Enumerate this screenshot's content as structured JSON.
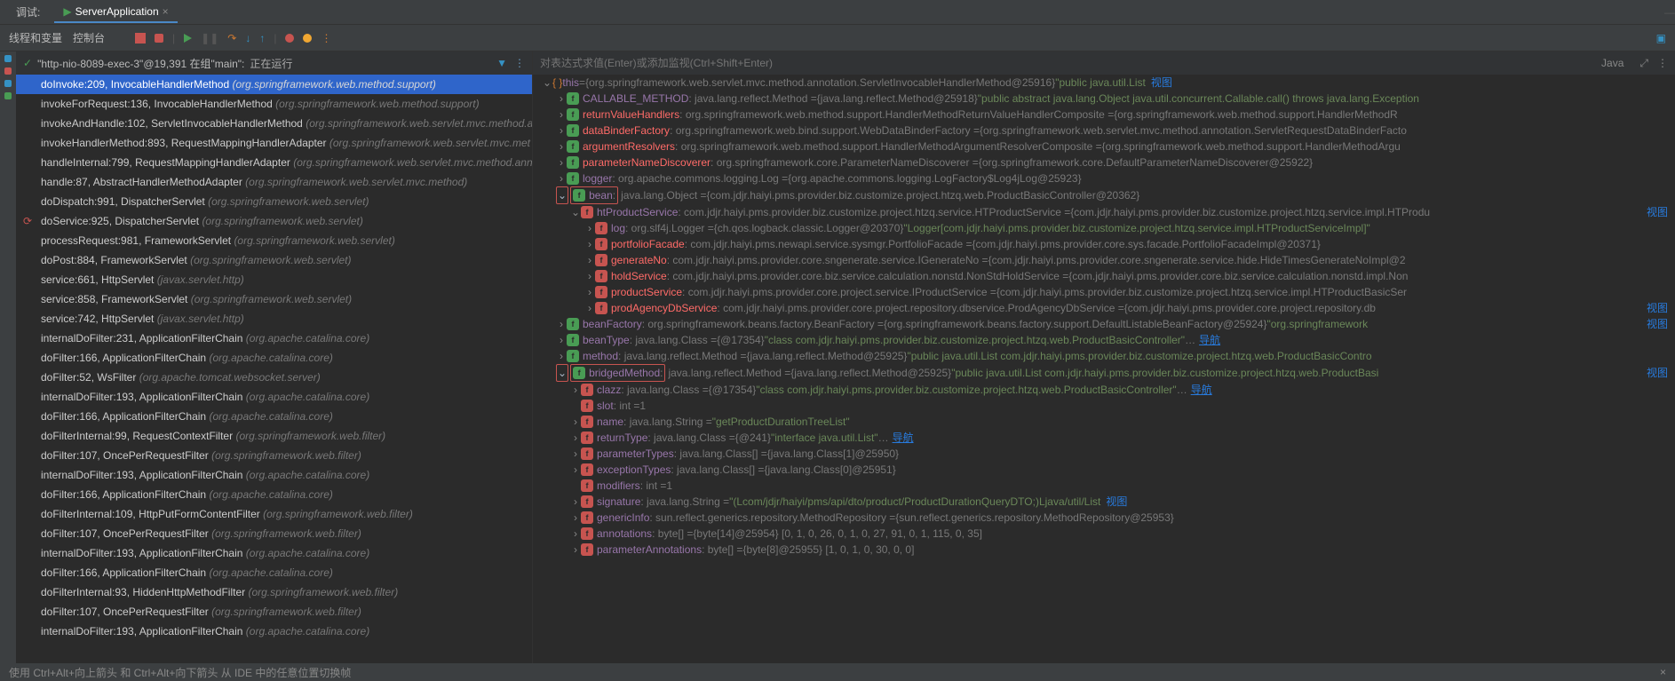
{
  "tabs": {
    "debug": "调试:",
    "app": "ServerApplication"
  },
  "toolbar": {
    "threads": "线程和变量",
    "console": "控制台"
  },
  "thread": {
    "prefix": "\"http-nio-8089-exec-3\"@19,391 在组\"main\":",
    "status": "正在运行"
  },
  "evaluator": {
    "placeholder": "对表达式求值(Enter)或添加监视(Ctrl+Shift+Enter)",
    "lang": "Java"
  },
  "viewLabel": "视图",
  "navLabel": "导航",
  "stack": [
    {
      "m": "doInvoke:209, InvocableHandlerMethod",
      "p": "(org.springframework.web.method.support)",
      "active": true
    },
    {
      "m": "invokeForRequest:136, InvocableHandlerMethod",
      "p": "(org.springframework.web.method.support)"
    },
    {
      "m": "invokeAndHandle:102, ServletInvocableHandlerMethod",
      "p": "(org.springframework.web.servlet.mvc.method.an"
    },
    {
      "m": "invokeHandlerMethod:893, RequestMappingHandlerAdapter",
      "p": "(org.springframework.web.servlet.mvc.met"
    },
    {
      "m": "handleInternal:799, RequestMappingHandlerAdapter",
      "p": "(org.springframework.web.servlet.mvc.method.ann"
    },
    {
      "m": "handle:87, AbstractHandlerMethodAdapter",
      "p": "(org.springframework.web.servlet.mvc.method)"
    },
    {
      "m": "doDispatch:991, DispatcherServlet",
      "p": "(org.springframework.web.servlet)"
    },
    {
      "m": "doService:925, DispatcherServlet",
      "p": "(org.springframework.web.servlet)",
      "refresh": true
    },
    {
      "m": "processRequest:981, FrameworkServlet",
      "p": "(org.springframework.web.servlet)"
    },
    {
      "m": "doPost:884, FrameworkServlet",
      "p": "(org.springframework.web.servlet)"
    },
    {
      "m": "service:661, HttpServlet",
      "p": "(javax.servlet.http)"
    },
    {
      "m": "service:858, FrameworkServlet",
      "p": "(org.springframework.web.servlet)"
    },
    {
      "m": "service:742, HttpServlet",
      "p": "(javax.servlet.http)"
    },
    {
      "m": "internalDoFilter:231, ApplicationFilterChain",
      "p": "(org.apache.catalina.core)"
    },
    {
      "m": "doFilter:166, ApplicationFilterChain",
      "p": "(org.apache.catalina.core)"
    },
    {
      "m": "doFilter:52, WsFilter",
      "p": "(org.apache.tomcat.websocket.server)"
    },
    {
      "m": "internalDoFilter:193, ApplicationFilterChain",
      "p": "(org.apache.catalina.core)"
    },
    {
      "m": "doFilter:166, ApplicationFilterChain",
      "p": "(org.apache.catalina.core)"
    },
    {
      "m": "doFilterInternal:99, RequestContextFilter",
      "p": "(org.springframework.web.filter)"
    },
    {
      "m": "doFilter:107, OncePerRequestFilter",
      "p": "(org.springframework.web.filter)"
    },
    {
      "m": "internalDoFilter:193, ApplicationFilterChain",
      "p": "(org.apache.catalina.core)"
    },
    {
      "m": "doFilter:166, ApplicationFilterChain",
      "p": "(org.apache.catalina.core)"
    },
    {
      "m": "doFilterInternal:109, HttpPutFormContentFilter",
      "p": "(org.springframework.web.filter)"
    },
    {
      "m": "doFilter:107, OncePerRequestFilter",
      "p": "(org.springframework.web.filter)"
    },
    {
      "m": "internalDoFilter:193, ApplicationFilterChain",
      "p": "(org.apache.catalina.core)"
    },
    {
      "m": "doFilter:166, ApplicationFilterChain",
      "p": "(org.apache.catalina.core)"
    },
    {
      "m": "doFilterInternal:93, HiddenHttpMethodFilter",
      "p": "(org.springframework.web.filter)"
    },
    {
      "m": "doFilter:107, OncePerRequestFilter",
      "p": "(org.springframework.web.filter)"
    },
    {
      "m": "internalDoFilter:193, ApplicationFilterChain",
      "p": "(org.apache.catalina.core)"
    }
  ],
  "vars": [
    {
      "d": 0,
      "arr": "v",
      "ic": "braces",
      "name": "this",
      "eq": " = ",
      "val": "{org.springframework.web.servlet.mvc.method.annotation.ServletInvocableHandlerMethod@25916} ",
      "str": "\"public java.util.List<com.jdjr.haiyi.pms.provider.biz.customize.proj",
      "view": true
    },
    {
      "d": 1,
      "arr": ">",
      "ic": "g",
      "name": "CALLABLE_METHOD",
      "red": false,
      "type": ": java.lang.reflect.Method  = ",
      "val": "{java.lang.reflect.Method@25918} ",
      "str": "\"public abstract java.lang.Object java.util.concurrent.Callable.call() throws java.lang.Exception"
    },
    {
      "d": 1,
      "arr": ">",
      "ic": "g",
      "name": "returnValueHandlers",
      "red": true,
      "type": ": org.springframework.web.method.support.HandlerMethodReturnValueHandlerComposite  = ",
      "val": "{org.springframework.web.method.support.HandlerMethodR"
    },
    {
      "d": 1,
      "arr": ">",
      "ic": "g",
      "name": "dataBinderFactory",
      "red": true,
      "type": ": org.springframework.web.bind.support.WebDataBinderFactory  = ",
      "val": "{org.springframework.web.servlet.mvc.method.annotation.ServletRequestDataBinderFacto"
    },
    {
      "d": 1,
      "arr": ">",
      "ic": "g",
      "name": "argumentResolvers",
      "red": true,
      "type": ": org.springframework.web.method.support.HandlerMethodArgumentResolverComposite  = ",
      "val": "{org.springframework.web.method.support.HandlerMethodArgu"
    },
    {
      "d": 1,
      "arr": ">",
      "ic": "g",
      "name": "parameterNameDiscoverer",
      "red": true,
      "type": ": org.springframework.core.ParameterNameDiscoverer  = ",
      "val": "{org.springframework.core.DefaultParameterNameDiscoverer@25922}"
    },
    {
      "d": 1,
      "arr": ">",
      "ic": "g",
      "name": "logger",
      "red": false,
      "type": ": org.apache.commons.logging.Log  = ",
      "val": "{org.apache.commons.logging.LogFactory$Log4jLog@25923}"
    },
    {
      "d": 1,
      "arr": "v",
      "ic": "g",
      "name": "bean",
      "red": false,
      "type": ": java.lang.Object  = ",
      "val": "{com.jdjr.haiyi.pms.provider.biz.customize.project.htzq.web.ProductBasicController@20362}",
      "hl": true,
      "hlArrow": true
    },
    {
      "d": 2,
      "arr": "v",
      "ic": "p",
      "name": "htProductService",
      "red": false,
      "type": ": com.jdjr.haiyi.pms.provider.biz.customize.project.htzq.service.HTProductService  = ",
      "val": "{com.jdjr.haiyi.pms.provider.biz.customize.project.htzq.service.impl.HTProdu",
      "view": true
    },
    {
      "d": 3,
      "arr": ">",
      "ic": "p",
      "name": "log",
      "red": false,
      "type": ": org.slf4j.Logger  = ",
      "val": "{ch.qos.logback.classic.Logger@20370} ",
      "str": "\"Logger[com.jdjr.haiyi.pms.provider.biz.customize.project.htzq.service.impl.HTProductServiceImpl]\""
    },
    {
      "d": 3,
      "arr": ">",
      "ic": "p",
      "name": "portfolioFacade",
      "red": true,
      "type": ": com.jdjr.haiyi.pms.newapi.service.sysmgr.PortfolioFacade  = ",
      "val": "{com.jdjr.haiyi.pms.provider.core.sys.facade.PortfolioFacadeImpl@20371}"
    },
    {
      "d": 3,
      "arr": ">",
      "ic": "p",
      "name": "generateNo",
      "red": true,
      "type": ": com.jdjr.haiyi.pms.provider.core.sngenerate.service.IGenerateNo  = ",
      "val": "{com.jdjr.haiyi.pms.provider.core.sngenerate.service.hide.HideTimesGenerateNoImpl@2"
    },
    {
      "d": 3,
      "arr": ">",
      "ic": "p",
      "name": "holdService",
      "red": true,
      "type": ": com.jdjr.haiyi.pms.provider.core.biz.service.calculation.nonstd.NonStdHoldService  = ",
      "val": "{com.jdjr.haiyi.pms.provider.core.biz.service.calculation.nonstd.impl.Non"
    },
    {
      "d": 3,
      "arr": ">",
      "ic": "p",
      "name": "productService",
      "red": true,
      "type": ": com.jdjr.haiyi.pms.provider.core.project.service.IProductService  = ",
      "val": "{com.jdjr.haiyi.pms.provider.biz.customize.project.htzq.service.impl.HTProductBasicSer"
    },
    {
      "d": 3,
      "arr": ">",
      "ic": "p",
      "name": "prodAgencyDbService",
      "red": true,
      "type": ": com.jdjr.haiyi.pms.provider.core.project.repository.dbservice.ProdAgencyDbService  = ",
      "val": "{com.jdjr.haiyi.pms.provider.core.project.repository.db",
      "view": true
    },
    {
      "d": 1,
      "arr": ">",
      "ic": "g",
      "name": "beanFactory",
      "red": false,
      "type": ": org.springframework.beans.factory.BeanFactory  = ",
      "val": "{org.springframework.beans.factory.support.DefaultListableBeanFactory@25924} ",
      "str": "\"org.springframework",
      "view": true
    },
    {
      "d": 1,
      "arr": ">",
      "ic": "g",
      "name": "beanType",
      "red": false,
      "type": ": java.lang.Class  = ",
      "val": "{@17354} ",
      "str": "\"class com.jdjr.haiyi.pms.provider.biz.customize.project.htzq.web.ProductBasicController\"",
      "nav": true
    },
    {
      "d": 1,
      "arr": ">",
      "ic": "g",
      "name": "method",
      "red": false,
      "type": ": java.lang.reflect.Method  = ",
      "val": "{java.lang.reflect.Method@25925} ",
      "str": "\"public java.util.List com.jdjr.haiyi.pms.provider.biz.customize.project.htzq.web.ProductBasicContro"
    },
    {
      "d": 1,
      "arr": "v",
      "ic": "g",
      "name": "bridgedMethod",
      "red": false,
      "type": ": java.lang.reflect.Method  = ",
      "val": "{java.lang.reflect.Method@25925} ",
      "str": "\"public java.util.List com.jdjr.haiyi.pms.provider.biz.customize.project.htzq.web.ProductBasi",
      "hl": true,
      "hlArrow": true,
      "view": true
    },
    {
      "d": 2,
      "arr": ">",
      "ic": "p",
      "name": "clazz",
      "red": false,
      "type": ": java.lang.Class  = ",
      "val": "{@17354} ",
      "str": "\"class com.jdjr.haiyi.pms.provider.biz.customize.project.htzq.web.ProductBasicController\"",
      "nav": true
    },
    {
      "d": 2,
      "arr": "",
      "ic": "p",
      "name": "slot",
      "red": false,
      "type": ": int  = ",
      "val": "1"
    },
    {
      "d": 2,
      "arr": ">",
      "ic": "p",
      "name": "name",
      "red": false,
      "type": ": java.lang.String  = ",
      "str": "\"getProductDurationTreeList\""
    },
    {
      "d": 2,
      "arr": ">",
      "ic": "p",
      "name": "returnType",
      "red": false,
      "type": ": java.lang.Class  = ",
      "val": "{@241} ",
      "str": "\"interface java.util.List\"",
      "nav": true
    },
    {
      "d": 2,
      "arr": ">",
      "ic": "p",
      "name": "parameterTypes",
      "red": false,
      "type": ": java.lang.Class[]  = ",
      "val": "{java.lang.Class[1]@25950}"
    },
    {
      "d": 2,
      "arr": ">",
      "ic": "p",
      "name": "exceptionTypes",
      "red": false,
      "type": ": java.lang.Class[]  = ",
      "val": "{java.lang.Class[0]@25951}"
    },
    {
      "d": 2,
      "arr": "",
      "ic": "p",
      "name": "modifiers",
      "red": false,
      "type": ": int  = ",
      "val": "1"
    },
    {
      "d": 2,
      "arr": ">",
      "ic": "p",
      "name": "signature",
      "red": false,
      "type": ": java.lang.String  = ",
      "str": "\"(Lcom/jdjr/haiyi/pms/api/dto/product/ProductDurationQueryDTO;)Ljava/util/List<Lcom/jdjr/haiyi/pms/provider/biz/customize/project/htzq/",
      "view": true
    },
    {
      "d": 2,
      "arr": ">",
      "ic": "p",
      "name": "genericInfo",
      "red": false,
      "type": ": sun.reflect.generics.repository.MethodRepository  = ",
      "val": "{sun.reflect.generics.repository.MethodRepository@25953}"
    },
    {
      "d": 2,
      "arr": ">",
      "ic": "p",
      "name": "annotations",
      "red": false,
      "type": ": byte[]  = ",
      "val": "{byte[14]@25954} [0, 1, 0, 26, 0, 1, 0, 27, 91, 0, 1, 115, 0, 35]"
    },
    {
      "d": 2,
      "arr": ">",
      "ic": "p",
      "name": "parameterAnnotations",
      "red": false,
      "type": ": byte[]  = ",
      "val": "{byte[8]@25955} [1, 0, 1, 0, 30, 0, 0]"
    }
  ],
  "footer": {
    "hint": "使用 Ctrl+Alt+向上箭头 和 Ctrl+Alt+向下箭头 从 IDE 中的任意位置切换帧",
    "x": "×"
  }
}
